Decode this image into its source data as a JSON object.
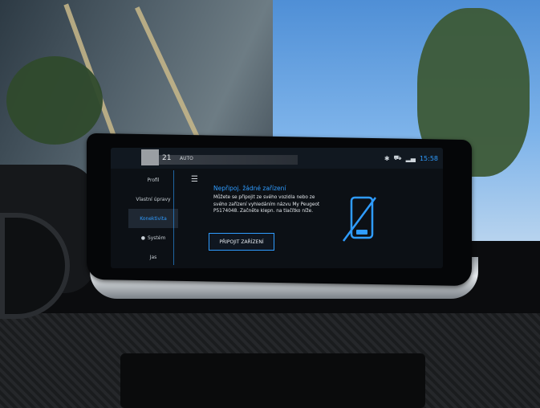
{
  "status": {
    "temperature": "21",
    "auto_label": "AUTO",
    "time": "15:58",
    "icons": [
      "bluetooth-icon",
      "car-icon",
      "signal-icon"
    ]
  },
  "sidebar": {
    "items": [
      {
        "label": "Profil"
      },
      {
        "label": "Vlastní úpravy"
      },
      {
        "label": "Konektivita"
      },
      {
        "label": "Systém"
      },
      {
        "label": "Jas"
      }
    ],
    "active_index": 2
  },
  "content": {
    "title": "Nepřipoj. žádné zařízení",
    "body": "Můžete se připojit ze svého vozidla nebo ze svého zařízení vyhledáním názvu My Peugeot P5174048. Začněte klepn. na tlačítko níže.",
    "button_label": "PŘIPOJIT ZAŘÍZENÍ"
  },
  "colors": {
    "accent": "#2f9cff",
    "screen_bg": "#0c1015"
  }
}
